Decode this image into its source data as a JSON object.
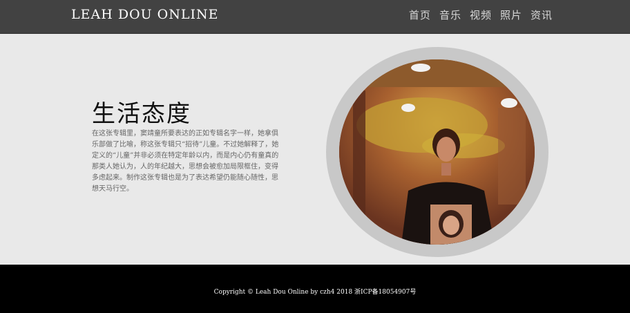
{
  "header": {
    "brand": "LEAH DOU ONLINE",
    "nav": [
      "首页",
      "音乐",
      "视频",
      "照片",
      "资讯"
    ]
  },
  "main": {
    "title": "生活态度",
    "text": "在这张专辑里，窦靖童所要表达的正如专辑名字一样，她拿俱乐部做了比喻，称这张专辑只“招待”儿童。不过她解释了，她定义的“儿童”并非必须在特定年龄以内，而是内心仍有童真的那类人她认为，人的年纪越大，思想会被愈加局限框住，变得多虑起来。制作这张专辑也是为了表达希望仍能随心随性，思想天马行空。"
  },
  "footer": {
    "copyright": "Copyright © Leah Dou Online by czh4 2018 浙ICP备18054907号"
  }
}
